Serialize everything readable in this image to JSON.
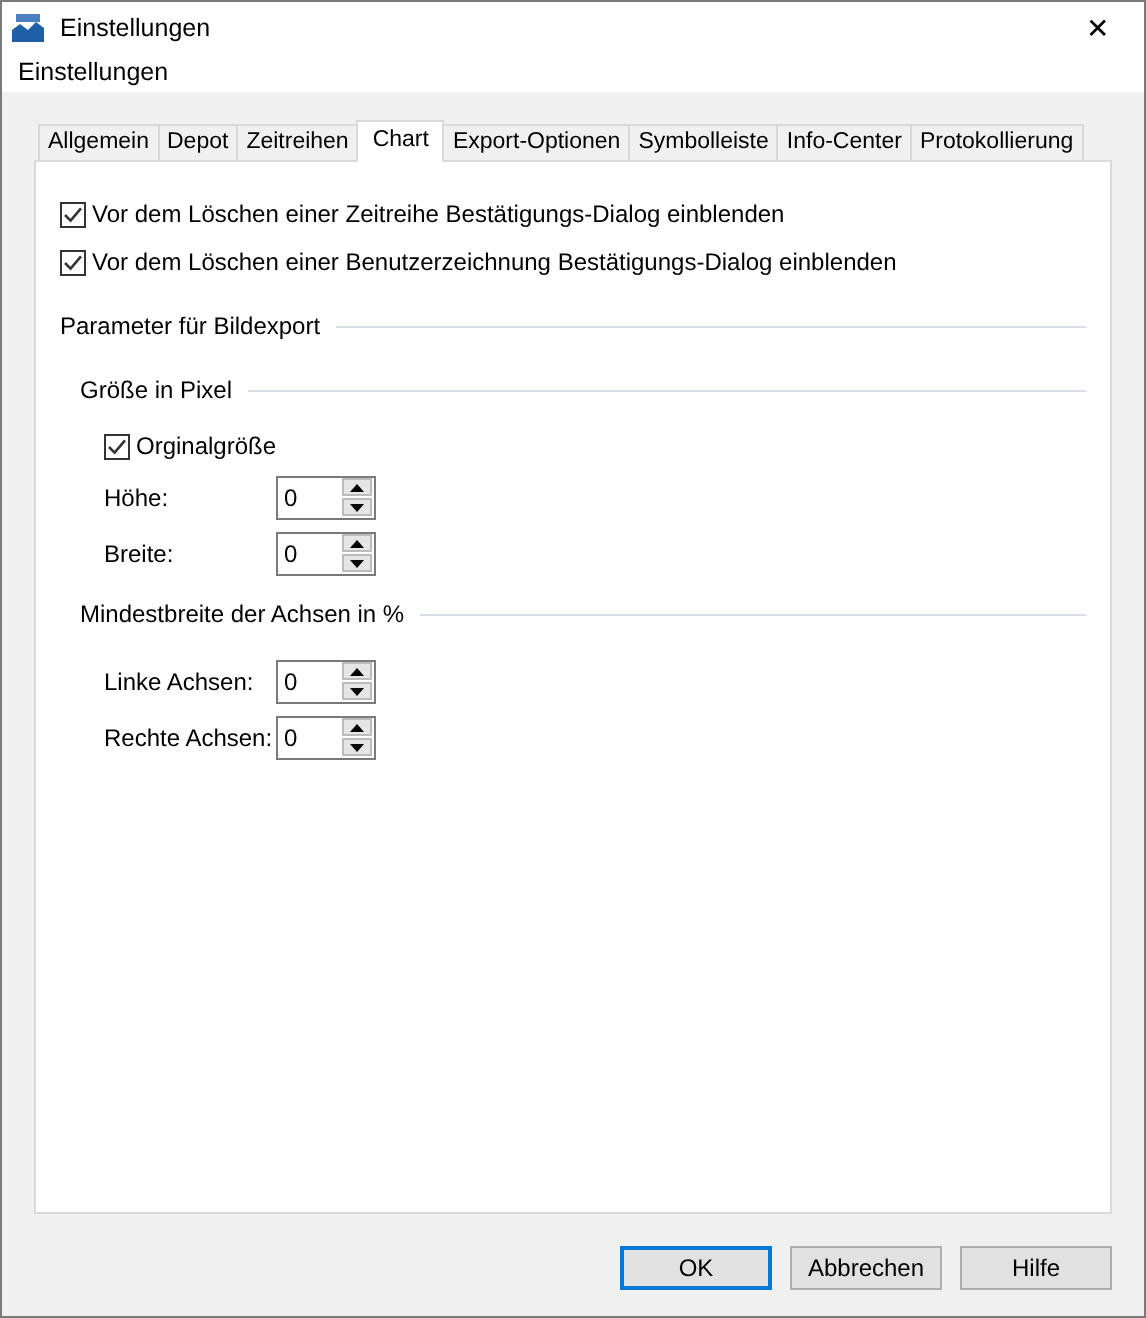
{
  "window": {
    "title": "Einstellungen",
    "close": "✕"
  },
  "header": "Einstellungen",
  "tabs": [
    {
      "label": "Allgemein",
      "selected": false
    },
    {
      "label": "Depot",
      "selected": false
    },
    {
      "label": "Zeitreihen",
      "selected": false
    },
    {
      "label": "Chart",
      "selected": true
    },
    {
      "label": "Export-Optionen",
      "selected": false
    },
    {
      "label": "Symbolleiste",
      "selected": false
    },
    {
      "label": "Info-Center",
      "selected": false
    },
    {
      "label": "Protokollierung",
      "selected": false
    }
  ],
  "options": [
    {
      "label": "Vor dem Löschen einer Zeitreihe Bestätigungs-Dialog einblenden",
      "checked": true
    },
    {
      "label": "Vor dem Löschen einer Benutzerzeichnung Bestätigungs-Dialog einblenden",
      "checked": true
    }
  ],
  "export": {
    "title": "Parameter für Bildexport",
    "size": {
      "title": "Größe in Pixel",
      "original": {
        "label": "Orginalgröße",
        "checked": true
      },
      "fields": [
        {
          "label": "Höhe:",
          "value": "0"
        },
        {
          "label": "Breite:",
          "value": "0"
        }
      ]
    },
    "axes": {
      "title": "Mindestbreite der Achsen in %",
      "fields": [
        {
          "label": "Linke Achsen:",
          "value": "0"
        },
        {
          "label": "Rechte Achsen:",
          "value": "0"
        }
      ]
    }
  },
  "buttons": [
    {
      "label": "OK",
      "default": true
    },
    {
      "label": "Abbrechen",
      "default": false
    },
    {
      "label": "Hilfe",
      "default": false
    }
  ]
}
